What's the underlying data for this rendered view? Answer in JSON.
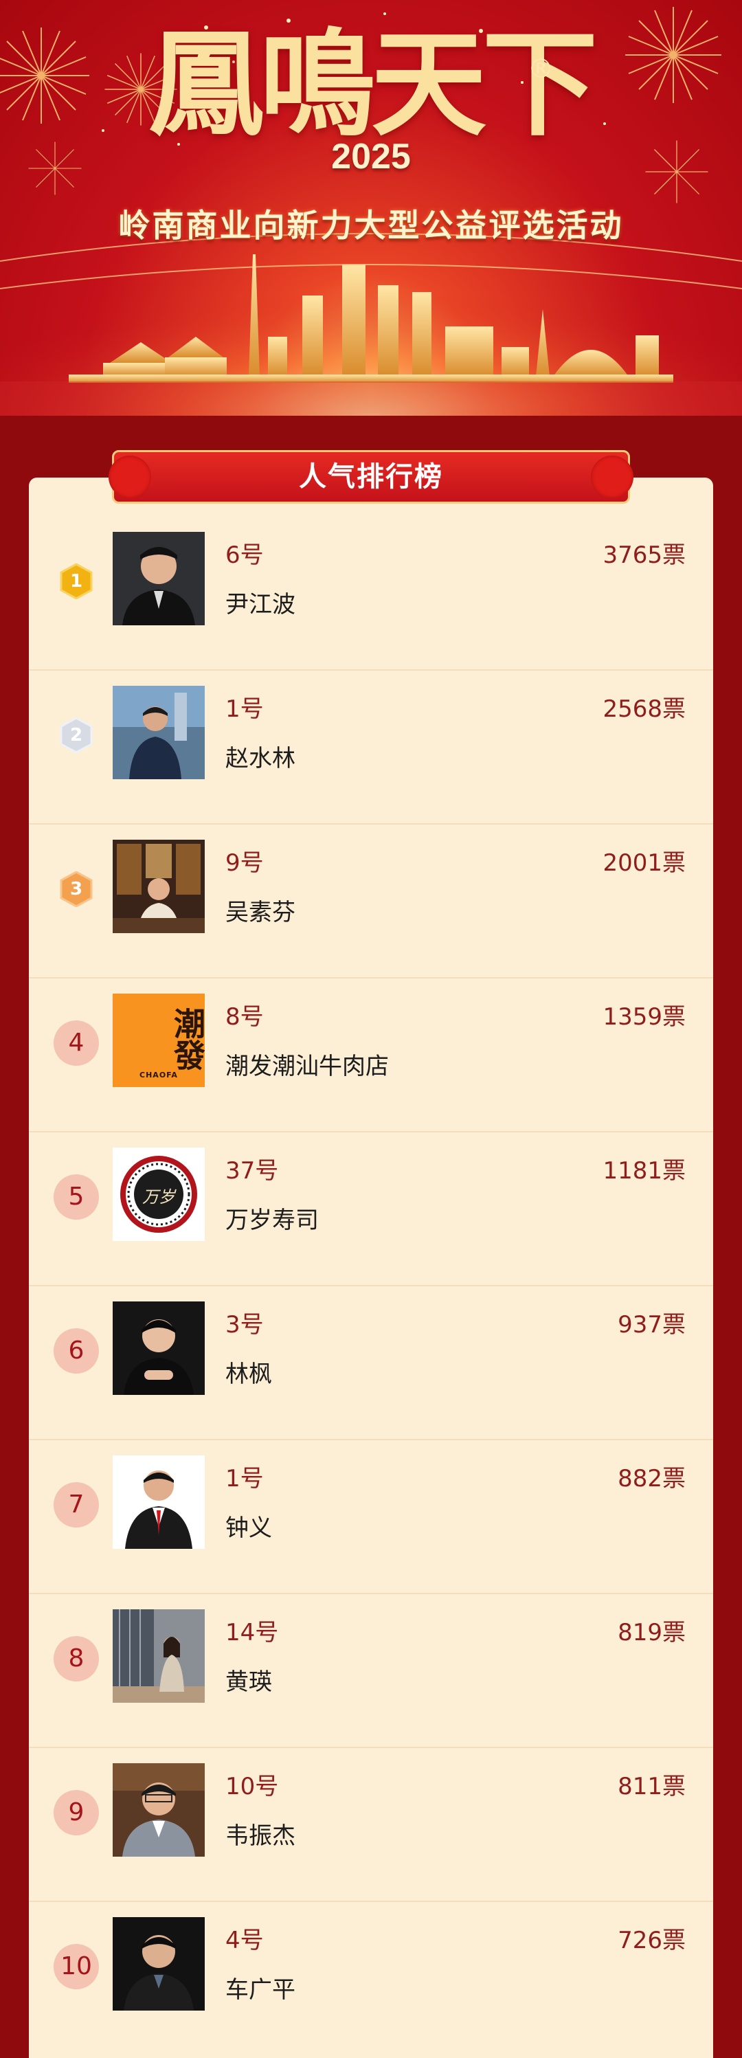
{
  "banner": {
    "logo_text": "鳳鳴天下",
    "logo_mark": "®",
    "year": "2025",
    "subtitle": "岭南商业向新力大型公益评选活动"
  },
  "ranking": {
    "title": "人气排行榜",
    "entries": [
      {
        "rank": "1",
        "entry_no": "6号",
        "name": "尹江波",
        "votes": "3765票"
      },
      {
        "rank": "2",
        "entry_no": "1号",
        "name": "赵水林",
        "votes": "2568票"
      },
      {
        "rank": "3",
        "entry_no": "9号",
        "name": "吴素芬",
        "votes": "2001票"
      },
      {
        "rank": "4",
        "entry_no": "8号",
        "name": "潮发潮汕牛肉店",
        "votes": "1359票"
      },
      {
        "rank": "5",
        "entry_no": "37号",
        "name": "万岁寿司",
        "votes": "1181票"
      },
      {
        "rank": "6",
        "entry_no": "3号",
        "name": "林枫",
        "votes": "937票"
      },
      {
        "rank": "7",
        "entry_no": "1号",
        "name": "钟义",
        "votes": "882票"
      },
      {
        "rank": "8",
        "entry_no": "14号",
        "name": "黄瑛",
        "votes": "819票"
      },
      {
        "rank": "9",
        "entry_no": "10号",
        "name": "韦振杰",
        "votes": "811票"
      },
      {
        "rank": "10",
        "entry_no": "4号",
        "name": "车广平",
        "votes": "726票"
      }
    ]
  },
  "logos": {
    "chaofa_title": "潮發",
    "chaofa_sub": "CHAOFA",
    "wansui_mark": "万岁"
  },
  "colors": {
    "gold_medal": "#f2b312",
    "silver_medal": "#d7dce4",
    "bronze_medal": "#f4a14f",
    "rank_circle": "#f4c3b1",
    "accent_red": "#c4121a"
  }
}
